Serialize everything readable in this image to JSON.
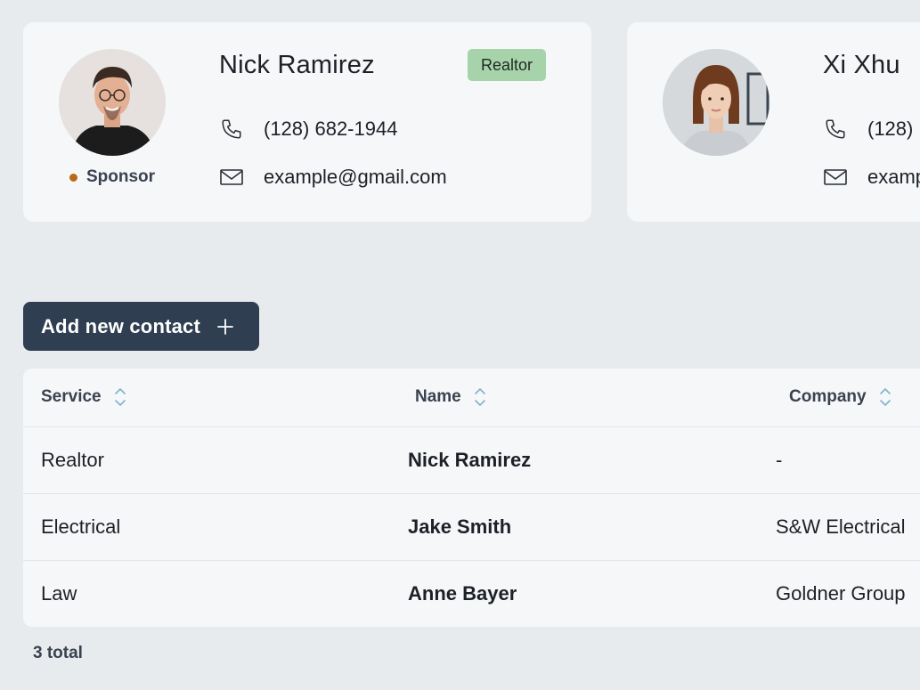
{
  "cards": [
    {
      "name": "Nick Ramirez",
      "tag": "Realtor",
      "role": "Sponsor",
      "phone": "(128) 682-1944",
      "email": "example@gmail.com"
    },
    {
      "name": "Xi Xhu",
      "phone": "(128)",
      "email": "examp"
    }
  ],
  "add_button": {
    "label": "Add new contact",
    "icon": "plus-icon"
  },
  "table": {
    "columns": [
      "Service",
      "Name",
      "Company"
    ],
    "rows": [
      {
        "service": "Realtor",
        "name": "Nick Ramirez",
        "company": "-"
      },
      {
        "service": "Electrical",
        "name": "Jake Smith",
        "company": "S&W Electrical"
      },
      {
        "service": "Law",
        "name": "Anne Bayer",
        "company": "Goldner Group"
      }
    ]
  },
  "footer": {
    "total": "3 total"
  },
  "colors": {
    "background": "#e8ebee",
    "card": "#f6f7f9",
    "button": "#2f3e51",
    "tag": "#a7d3aa",
    "status_dot": "#b86a12",
    "sort_icon": "#7fb4c8"
  }
}
